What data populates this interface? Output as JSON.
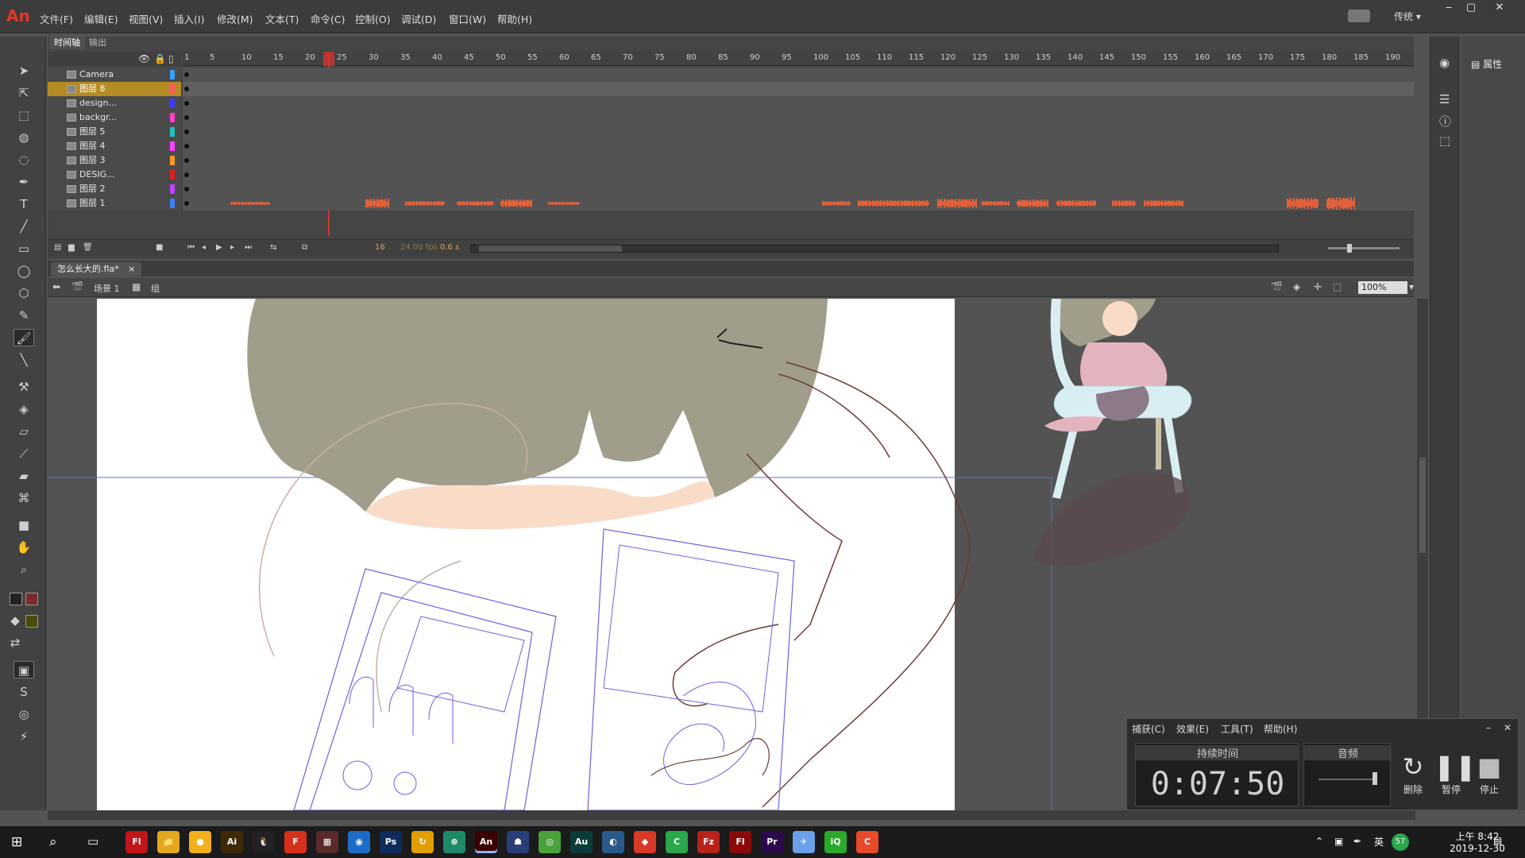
{
  "app": {
    "logo": "An"
  },
  "menu": [
    "文件(F)",
    "编辑(E)",
    "视图(V)",
    "插入(I)",
    "修改(M)",
    "文本(T)",
    "命令(C)",
    "控制(O)",
    "调试(D)",
    "窗口(W)",
    "帮助(H)"
  ],
  "workspace": {
    "label": "传统"
  },
  "timeline": {
    "tabs": [
      "时间轴",
      "输出"
    ],
    "ticks": [
      "1",
      "5",
      "10",
      "15",
      "20",
      "25",
      "30",
      "35",
      "40",
      "45",
      "50",
      "55",
      "60",
      "65",
      "70",
      "75",
      "80",
      "85",
      "90",
      "95",
      "100",
      "105",
      "110",
      "115",
      "120",
      "125",
      "130",
      "135",
      "140",
      "145",
      "150",
      "155",
      "160",
      "165",
      "170",
      "175",
      "180",
      "185",
      "190"
    ],
    "layers": [
      {
        "name": "Camera",
        "color": "#3da0ff"
      },
      {
        "name": "图层 8",
        "color": "#ff5c5c",
        "active": true
      },
      {
        "name": "design...",
        "color": "#3c3cff"
      },
      {
        "name": "backgr...",
        "color": "#ff3ccc"
      },
      {
        "name": "图层 5",
        "color": "#20c0c0"
      },
      {
        "name": "图层 4",
        "color": "#ff40ff"
      },
      {
        "name": "图层 3",
        "color": "#ff9a20"
      },
      {
        "name": "DESIG...",
        "color": "#e02020"
      },
      {
        "name": "图层 2",
        "color": "#c040ff"
      },
      {
        "name": "图层 1",
        "color": "#4080ff"
      }
    ],
    "current_frame": "16",
    "fps": "24.00 fps",
    "elapsed": "0.6 s"
  },
  "document": {
    "tab": "怎么长大的.fla*",
    "scene": "场景 1",
    "group": "组",
    "zoom": "100%"
  },
  "properties": {
    "tab": "属性"
  },
  "recorder": {
    "menu": [
      "捕获(C)",
      "效果(E)",
      "工具(T)",
      "帮助(H)"
    ],
    "duration_label": "持续时间",
    "duration": "0:07:50",
    "audio_label": "音频",
    "buttons": [
      "删除",
      "暂停",
      "停止"
    ]
  },
  "taskbar": {
    "apps": [
      {
        "label": "Fl",
        "color": "#c0151b"
      },
      {
        "label": "📁",
        "color": "#e3a81f"
      },
      {
        "label": "●",
        "color": "#f2b01c"
      },
      {
        "label": "Ai",
        "color": "#3d2a05"
      },
      {
        "label": "🐧",
        "color": "#222"
      },
      {
        "label": "F",
        "color": "#d6301b"
      },
      {
        "label": "▦",
        "color": "#5a2a2a"
      },
      {
        "label": "◉",
        "color": "#1c6cc7"
      },
      {
        "label": "Ps",
        "color": "#0f2b5b"
      },
      {
        "label": "↻",
        "color": "#e2a000"
      },
      {
        "label": "⊗",
        "color": "#1e8a6a"
      },
      {
        "label": "An",
        "color": "#3b0000",
        "active": true
      },
      {
        "label": "☗",
        "color": "#2a3e7a"
      },
      {
        "label": "◎",
        "color": "#4aa23a"
      },
      {
        "label": "Au",
        "color": "#0a3b3b"
      },
      {
        "label": "◐",
        "color": "#2a5a8a"
      },
      {
        "label": "◆",
        "color": "#d83a2a"
      },
      {
        "label": "C",
        "color": "#2aa84a"
      },
      {
        "label": "Fz",
        "color": "#b8221a"
      },
      {
        "label": "Fl",
        "color": "#8a0a0a"
      },
      {
        "label": "Pr",
        "color": "#2a0a4a"
      },
      {
        "label": "✈",
        "color": "#6aa0e8"
      },
      {
        "label": "iQ",
        "color": "#2aaa2a"
      },
      {
        "label": "C",
        "color": "#e84a2a"
      }
    ],
    "tray_badge": "57",
    "ime": "英",
    "time": "上午 8:42",
    "date": "2019-12-30"
  }
}
